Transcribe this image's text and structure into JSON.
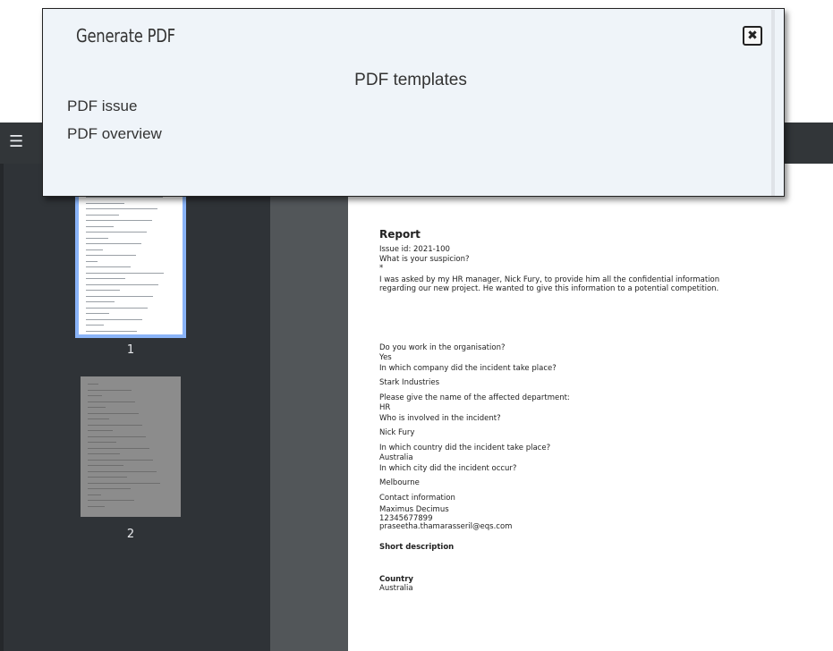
{
  "modal": {
    "title": "Generate PDF",
    "subtitle": "PDF templates",
    "templates": [
      "PDF issue",
      "PDF overview"
    ],
    "close_icon": "close-icon"
  },
  "viewer": {
    "menu_icon": "hamburger-menu-icon",
    "thumbnails": [
      "1",
      "2"
    ],
    "selected_page": "1"
  },
  "document": {
    "title": "Report",
    "lines": [
      "Issue id: 2021-100",
      "What is your suspicion?",
      "*",
      "I was asked by my HR manager, Nick Fury, to provide him all the confidential information",
      "regarding our new project. He wanted to give this information to a potential competition.",
      "Do you work in the organisation?",
      "Yes",
      "In which company did the incident take place?",
      "Stark Industries",
      "Please give the name of the affected department:",
      "HR",
      "Who is involved in the incident?",
      "Nick Fury",
      "In which country did the incident take place?",
      "Australia",
      "In which city did the incident occur?",
      "Melbourne",
      "Contact information",
      "Maximus Decimus",
      "12345677899",
      "praseetha.thamarasseril@eqs.com",
      "Short description",
      "Country",
      "Australia"
    ]
  }
}
